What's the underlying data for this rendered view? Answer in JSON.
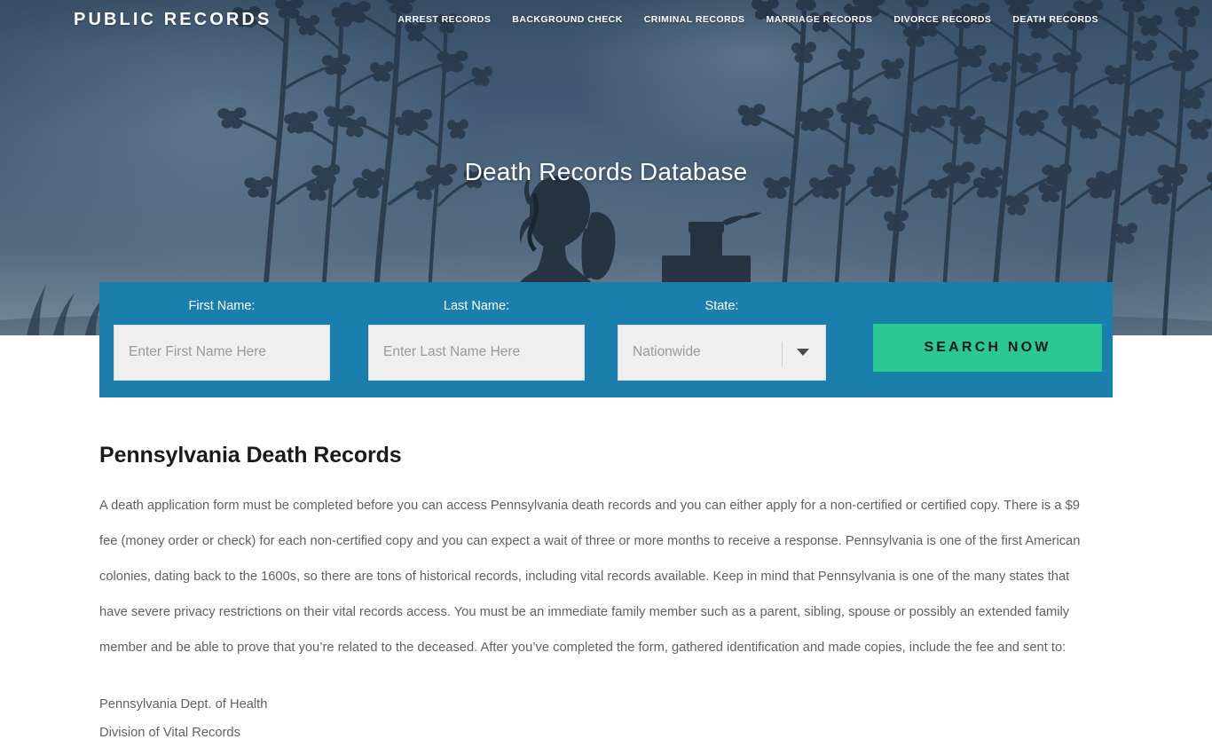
{
  "site": {
    "brand": "PUBLIC RECORDS"
  },
  "nav": {
    "items": [
      {
        "label": "ARREST RECORDS"
      },
      {
        "label": "BACKGROUND CHECK"
      },
      {
        "label": "CRIMINAL RECORDS"
      },
      {
        "label": "MARRIAGE RECORDS"
      },
      {
        "label": "DIVORCE RECORDS"
      },
      {
        "label": "DEATH RECORDS"
      }
    ]
  },
  "hero": {
    "title": "Death Records Database",
    "background_description": "blue dusk sky with silhouetted tree branches, a kneeling praying figure and a cross headstone"
  },
  "search_form": {
    "background_color": "#1a7fad",
    "first_name": {
      "label": "First Name:",
      "placeholder": "Enter First Name Here",
      "value": ""
    },
    "last_name": {
      "label": "Last Name:",
      "placeholder": "Enter Last Name Here",
      "value": ""
    },
    "state": {
      "label": "State:",
      "selected": "Nationwide"
    },
    "submit": {
      "label": "SEARCH NOW",
      "color": "#2bc894"
    }
  },
  "main": {
    "title": "Pennsylvania Death Records",
    "paragraph": "A death application form must be completed before you can access Pennsylvania death records and you can either apply for a non-certified or certified copy. There is a $9 fee (money order or check) for each non-certified copy and you can expect a wait of three or more months to receive a response. Pennsylvania is one of the first American colonies, dating back to the 1600s, so there are tons of historical records, including vital records available. Keep in mind that Pennsylvania is one of the many states that have severe privacy restrictions on their vital records access. You must be an immediate family member such as a parent, sibling, spouse or possibly an extended family member and be able to prove that you’re related to the deceased. After you’ve completed the form, gathered identification and made copies, include the fee and sent to:",
    "address_line_1": "Pennsylvania Dept. of Health",
    "address_line_2": "Division of Vital Records"
  }
}
